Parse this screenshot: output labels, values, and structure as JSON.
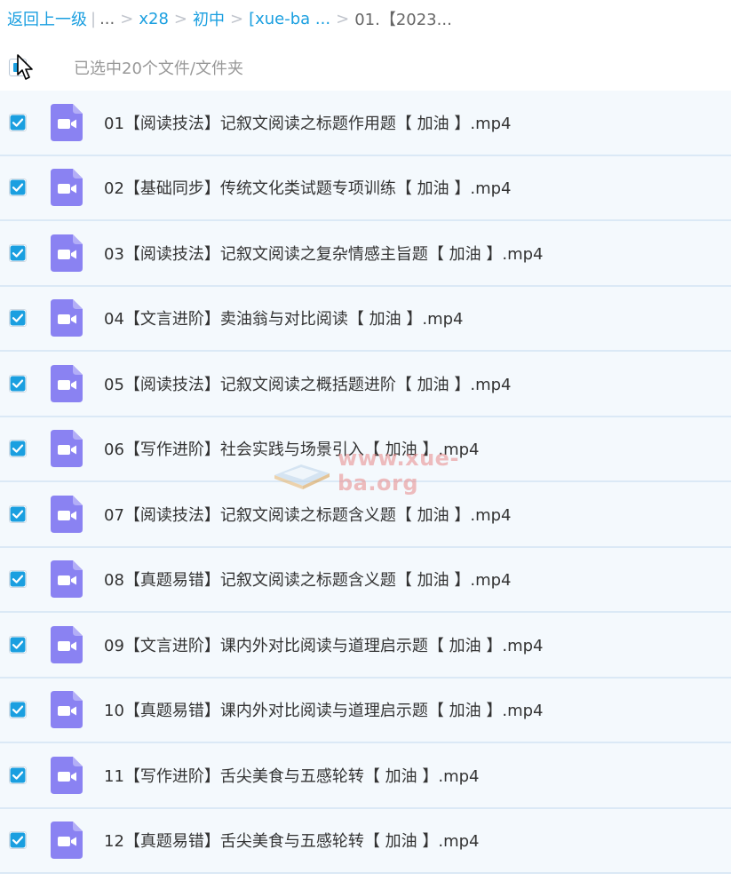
{
  "breadcrumb": {
    "back": "返回上一级",
    "pipe": "|",
    "ellipsis": "...",
    "sep": ">",
    "items": [
      "x28",
      "初中",
      "[xue-ba ..."
    ],
    "current": "01.【2023..."
  },
  "selection": {
    "text": "已选中20个文件/文件夹"
  },
  "files": [
    "01【阅读技法】记叙文阅读之标题作用题【 加油 】.mp4",
    "02【基础同步】传统文化类试题专项训练【 加油 】.mp4",
    "03【阅读技法】记叙文阅读之复杂情感主旨题【 加油 】.mp4",
    "04【文言进阶】卖油翁与对比阅读【 加油 】.mp4",
    "05【阅读技法】记叙文阅读之概括题进阶【 加油 】.mp4",
    "06【写作进阶】社会实践与场景引入【 加油 】.mp4",
    "07【阅读技法】记叙文阅读之标题含义题【 加油 】.mp4",
    "08【真题易错】记叙文阅读之标题含义题【 加油 】.mp4",
    "09【文言进阶】课内外对比阅读与道理启示题【 加油 】.mp4",
    "10【真题易错】课内外对比阅读与道理启示题【 加油 】.mp4",
    "11【写作进阶】舌尖美食与五感轮转【 加油 】.mp4",
    "12【真题易错】舌尖美食与五感轮转【 加油 】.mp4"
  ],
  "watermark": "www.xue-ba.org",
  "colors": {
    "accent": "#1a9fe0",
    "video_icon": "#8a82f2",
    "row_bg": "#f4f9fd"
  }
}
